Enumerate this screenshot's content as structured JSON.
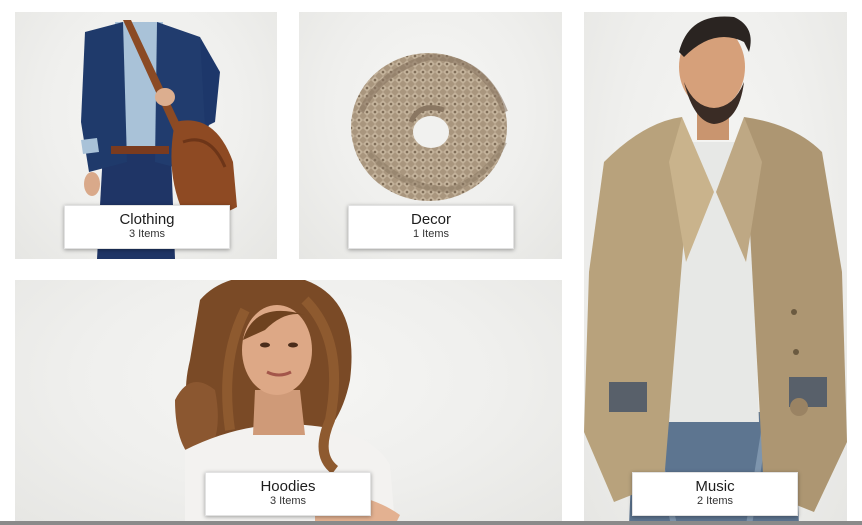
{
  "categories": [
    {
      "id": "clothing",
      "name": "Clothing",
      "count": "3 Items",
      "icon": "man-with-bag-photo"
    },
    {
      "id": "decor",
      "name": "Decor",
      "count": "1 Items",
      "icon": "knit-scarf-photo"
    },
    {
      "id": "music",
      "name": "Music",
      "count": "2 Items",
      "icon": "man-in-trench-coat-photo"
    },
    {
      "id": "hoodies",
      "name": "Hoodies",
      "count": "3 Items",
      "icon": "woman-portrait-photo"
    }
  ],
  "colors": {
    "tile_background": "#efefed",
    "caption_background": "#ffffff",
    "text": "#1d1d1d"
  }
}
